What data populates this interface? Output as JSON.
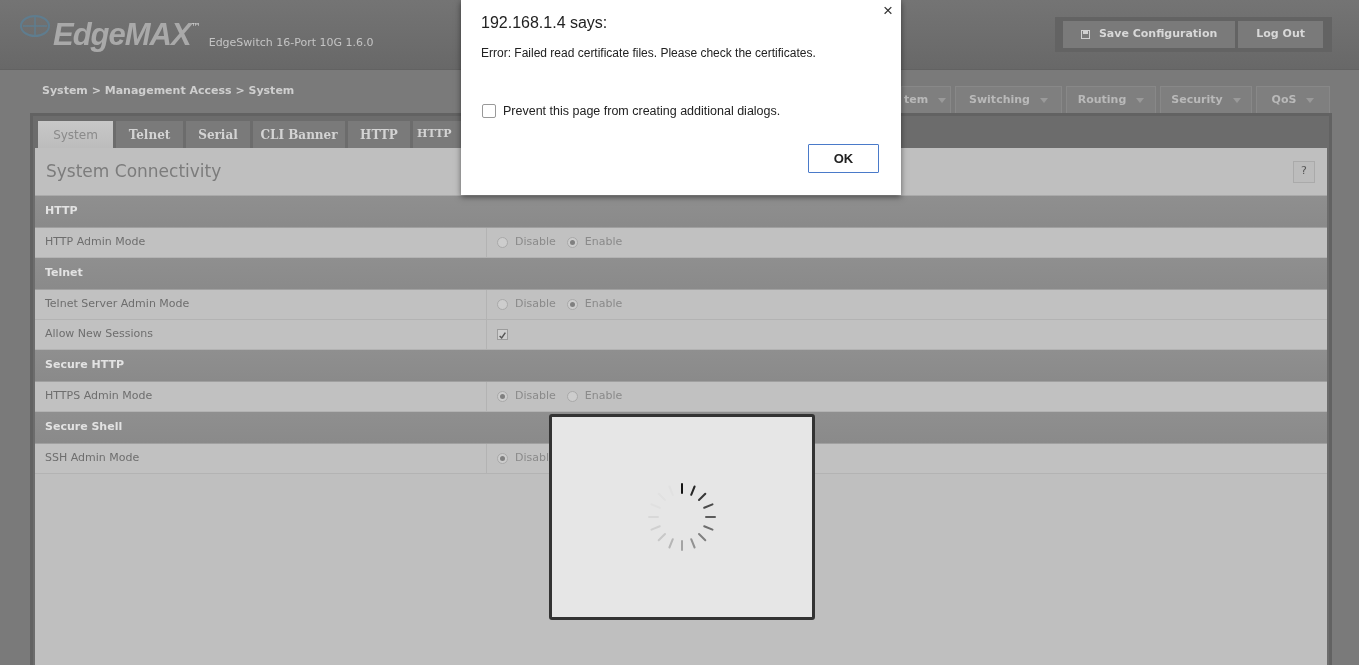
{
  "header": {
    "logo": "EdgeMAX",
    "trademark": "™",
    "product": "EdgeSwitch 16-Port 10G 1.6.0",
    "buttons": [
      {
        "label": "Save Configuration",
        "kind": "save"
      },
      {
        "label": "Log Out",
        "kind": "plain"
      }
    ]
  },
  "breadcrumb": "System > Management Access > System",
  "nav_menu": [
    {
      "label": "tem"
    },
    {
      "label": "Switching"
    },
    {
      "label": "Routing"
    },
    {
      "label": "Security"
    },
    {
      "label": "QoS"
    }
  ],
  "tabs": [
    {
      "label": "System",
      "selected": true
    },
    {
      "label": "Telnet",
      "selected": false
    },
    {
      "label": "Serial",
      "selected": false
    },
    {
      "label": "CLI Banner",
      "selected": false
    },
    {
      "label": "HTTP",
      "selected": false
    },
    {
      "label": "HTTP",
      "selected": false
    }
  ],
  "panel": {
    "title": "System Connectivity",
    "help": "?"
  },
  "sections": [
    {
      "title": "HTTP",
      "rows": [
        {
          "label": "HTTP Admin Mode",
          "kind": "radio",
          "options": [
            {
              "label": "Disable",
              "selected": false
            },
            {
              "label": "Enable",
              "selected": true
            }
          ]
        }
      ]
    },
    {
      "title": "Telnet",
      "rows": [
        {
          "label": "Telnet Server Admin Mode",
          "kind": "radio",
          "options": [
            {
              "label": "Disable",
              "selected": false
            },
            {
              "label": "Enable",
              "selected": true
            }
          ]
        },
        {
          "label": "Allow New Sessions",
          "kind": "checkbox",
          "checked": true
        }
      ]
    },
    {
      "title": "Secure HTTP",
      "rows": [
        {
          "label": "HTTPS Admin Mode",
          "kind": "radio",
          "options": [
            {
              "label": "Disable",
              "selected": true
            },
            {
              "label": "Enable",
              "selected": false
            }
          ]
        }
      ]
    },
    {
      "title": "Secure Shell",
      "rows": [
        {
          "label": "SSH Admin Mode",
          "kind": "radio",
          "options": [
            {
              "label": "Disabl",
              "selected": true
            }
          ]
        }
      ]
    }
  ],
  "dialog": {
    "title": "192.168.1.4 says:",
    "close": "×",
    "message": "Error: Failed read certificate files. Please check the certificates.",
    "option": {
      "label": "Prevent this page from creating additional dialogs.",
      "checked": false
    },
    "button": "OK"
  },
  "loading": {
    "kind": "spinner"
  }
}
